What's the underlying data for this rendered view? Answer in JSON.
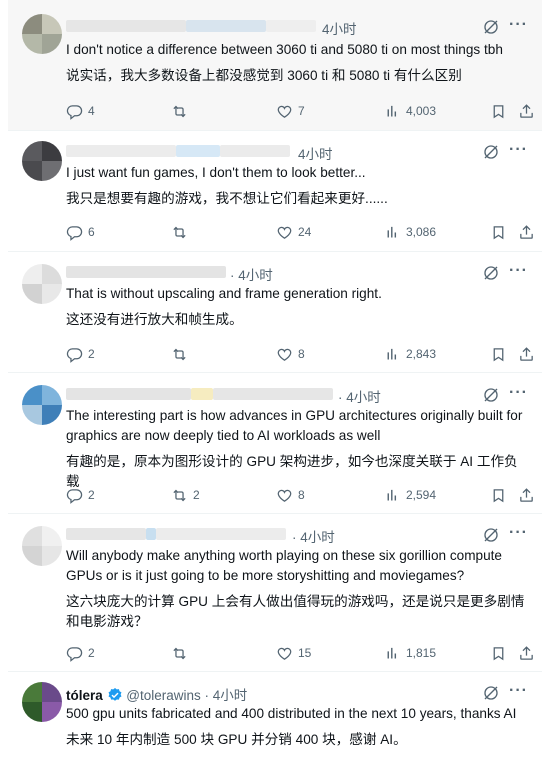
{
  "tweets": [
    {
      "time": "4小时",
      "text": "I don't notice a difference between 3060 ti and 5080 ti on most things tbh",
      "translation": "说实话，我大多数设备上都没感觉到 3060 ti 和 5080 ti 有什么区别",
      "replies": "4",
      "retweets": "",
      "likes": "7",
      "views": "4,003"
    },
    {
      "time": "4小时",
      "text": "I just want fun games, I don't them to look better...",
      "translation": "我只是想要有趣的游戏，我不想让它们看起来更好......",
      "replies": "6",
      "retweets": "",
      "likes": "24",
      "views": "3,086"
    },
    {
      "time": "· 4小时",
      "text": "That is without upscaling and frame generation right.",
      "translation": "这还没有进行放大和帧生成。",
      "replies": "2",
      "retweets": "",
      "likes": "8",
      "views": "2,843"
    },
    {
      "time": "· 4小时",
      "text": "The interesting part is how advances in GPU architectures originally built for graphics are now deeply tied to AI workloads as well",
      "translation": "有趣的是，原本为图形设计的 GPU 架构进步，如今也深度关联于 AI 工作负载",
      "replies": "2",
      "retweets": "2",
      "likes": "8",
      "views": "2,594"
    },
    {
      "time": "· 4小时",
      "text": "Will anybody make anything worth playing on these six gorillion compute GPUs or is it just going to be more storyshitting and moviegames?",
      "translation": "这六块庞大的计算 GPU 上会有人做出值得玩的游戏吗，还是说只是更多剧情和电影游戏？",
      "replies": "2",
      "retweets": "",
      "likes": "15",
      "views": "1,815"
    },
    {
      "name": "tólera",
      "handle": "@tolerawins",
      "time": "· 4小时",
      "text": "500 gpu units fabricated and 400 distributed in the next 10 years, thanks AI",
      "translation": "未来 10 年内制造 500 块 GPU 并分销 400 块，感谢 AI。"
    }
  ],
  "more_glyph": "···",
  "colors": {
    "text": "#0f1419",
    "muted": "#536471",
    "verified": "#1d9bf0",
    "highlight_bg": "#f7f7f7"
  }
}
